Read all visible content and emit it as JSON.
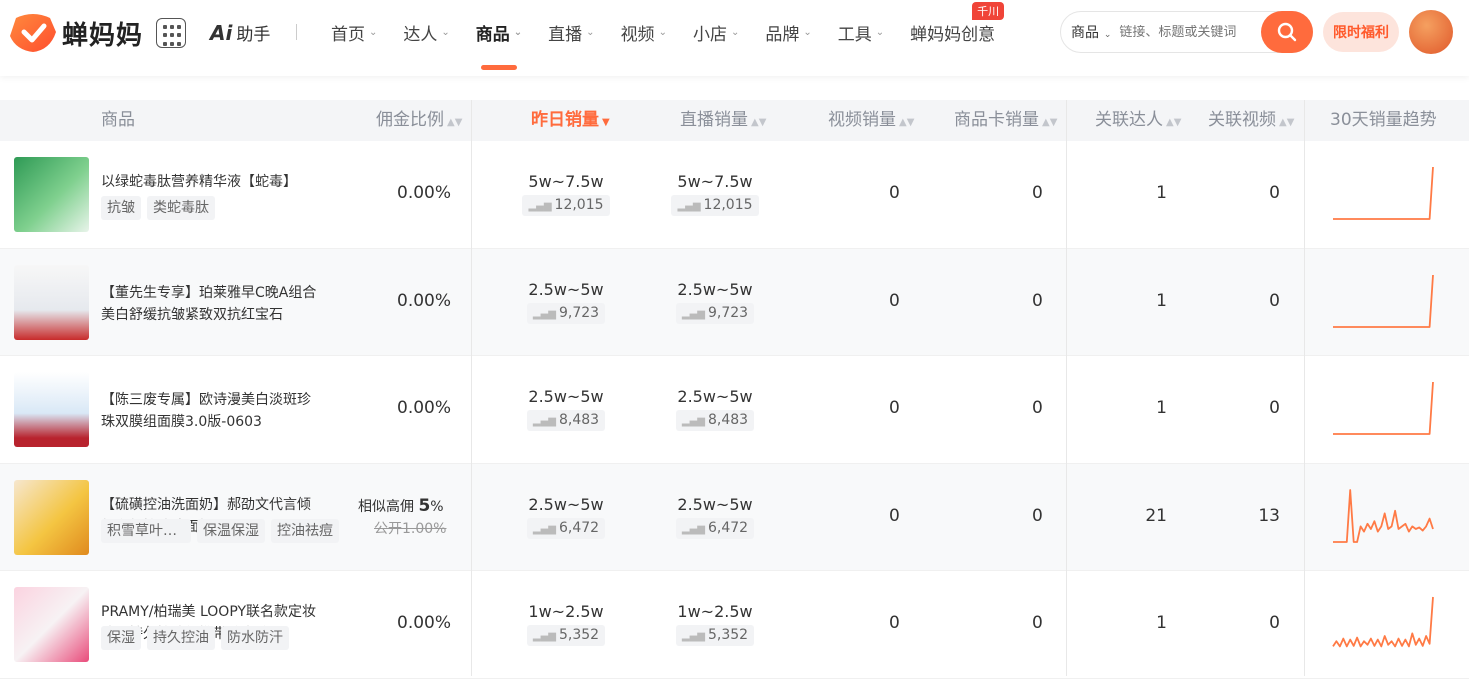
{
  "header": {
    "brand": "蝉妈妈",
    "ai_label": "助手",
    "nav": [
      {
        "label": "首页",
        "active": false
      },
      {
        "label": "达人",
        "active": false
      },
      {
        "label": "商品",
        "active": true
      },
      {
        "label": "直播",
        "active": false
      },
      {
        "label": "视频",
        "active": false
      },
      {
        "label": "小店",
        "active": false
      },
      {
        "label": "品牌",
        "active": false
      },
      {
        "label": "工具",
        "active": false
      },
      {
        "label": "蝉妈妈创意",
        "active": false
      }
    ],
    "nav_badge": "千川",
    "search": {
      "type": "商品",
      "placeholder": "链接、标题或关键词"
    },
    "promo": "限时福利"
  },
  "table": {
    "columns": {
      "product": "商品",
      "commission": "佣金比例",
      "yesterday_sales": "昨日销量",
      "live_sales": "直播销量",
      "video_sales": "视频销量",
      "card_sales": "商品卡销量",
      "influencers": "关联达人",
      "videos": "关联视频",
      "trend": "30天销量趋势"
    },
    "rows": [
      {
        "name": "以绿蛇毒肽营养精华液【蛇毒】",
        "tags": [
          "抗皱",
          "类蛇毒肽"
        ],
        "commission": "0.00%",
        "yesterday_range": "5w~7.5w",
        "yesterday_count": "12,015",
        "live_range": "5w~7.5w",
        "live_count": "12,015",
        "video_sales": "0",
        "card_sales": "0",
        "influencers": "1",
        "videos": "0",
        "trend": [
          0,
          0,
          0,
          0,
          0,
          0,
          0,
          0,
          0,
          0,
          0,
          0,
          0,
          0,
          0,
          0,
          0,
          0,
          0,
          0,
          0,
          0,
          0,
          0,
          0,
          0,
          0,
          0,
          0,
          100
        ]
      },
      {
        "name": "【董先生专享】珀莱雅早C晚A组合美白舒缓抗皱紧致双抗红宝石",
        "tags": [],
        "commission": "0.00%",
        "yesterday_range": "2.5w~5w",
        "yesterday_count": "9,723",
        "live_range": "2.5w~5w",
        "live_count": "9,723",
        "video_sales": "0",
        "card_sales": "0",
        "influencers": "1",
        "videos": "0",
        "trend": [
          0,
          0,
          0,
          0,
          0,
          0,
          0,
          0,
          0,
          0,
          0,
          0,
          0,
          0,
          0,
          0,
          0,
          0,
          0,
          0,
          0,
          0,
          0,
          0,
          0,
          0,
          0,
          0,
          0,
          100
        ]
      },
      {
        "name": "【陈三废专属】欧诗漫美白淡斑珍珠双膜组面膜3.0版-0603",
        "tags": [],
        "commission": "0.00%",
        "yesterday_range": "2.5w~5w",
        "yesterday_count": "8,483",
        "live_range": "2.5w~5w",
        "live_count": "8,483",
        "video_sales": "0",
        "card_sales": "0",
        "influencers": "1",
        "videos": "0",
        "trend": [
          0,
          0,
          0,
          0,
          0,
          0,
          0,
          0,
          0,
          0,
          0,
          0,
          0,
          0,
          0,
          0,
          0,
          0,
          0,
          0,
          0,
          0,
          0,
          0,
          0,
          0,
          0,
          0,
          0,
          100
        ]
      },
      {
        "name": "【硫磺控油洗面奶】郝劭文代言倾颜净颜控油洗面奶",
        "tags": [
          "积雪草叶提取物",
          "保温保湿",
          "控油祛痘"
        ],
        "commission_high_label": "相似高佣",
        "commission_high": "5",
        "commission_high_unit": "%",
        "commission_public": "公开1.00%",
        "yesterday_range": "2.5w~5w",
        "yesterday_count": "6,472",
        "live_range": "2.5w~5w",
        "live_count": "6,472",
        "video_sales": "0",
        "card_sales": "0",
        "influencers": "21",
        "videos": "13",
        "trend": [
          0,
          0,
          0,
          0,
          0,
          100,
          0,
          0,
          30,
          20,
          35,
          25,
          40,
          20,
          30,
          55,
          25,
          30,
          60,
          25,
          30,
          35,
          20,
          30,
          25,
          28,
          22,
          30,
          45,
          25
        ]
      },
      {
        "name": "PRAMY/柏瑞美 LOOPY联名款定妆喷雾持久控油便携带防水防汗",
        "tags": [
          "保湿",
          "持久控油",
          "防水防汗"
        ],
        "commission": "0.00%",
        "yesterday_range": "1w~2.5w",
        "yesterday_count": "5,352",
        "live_range": "1w~2.5w",
        "live_count": "5,352",
        "video_sales": "0",
        "card_sales": "0",
        "influencers": "1",
        "videos": "0",
        "trend": [
          5,
          15,
          5,
          20,
          5,
          18,
          6,
          22,
          5,
          15,
          8,
          20,
          6,
          18,
          5,
          25,
          8,
          15,
          5,
          20,
          6,
          18,
          5,
          30,
          8,
          20,
          6,
          25,
          10,
          100
        ]
      }
    ]
  },
  "colors": {
    "accent": "#ff6b3d",
    "trend_line": "#ff7a45"
  }
}
